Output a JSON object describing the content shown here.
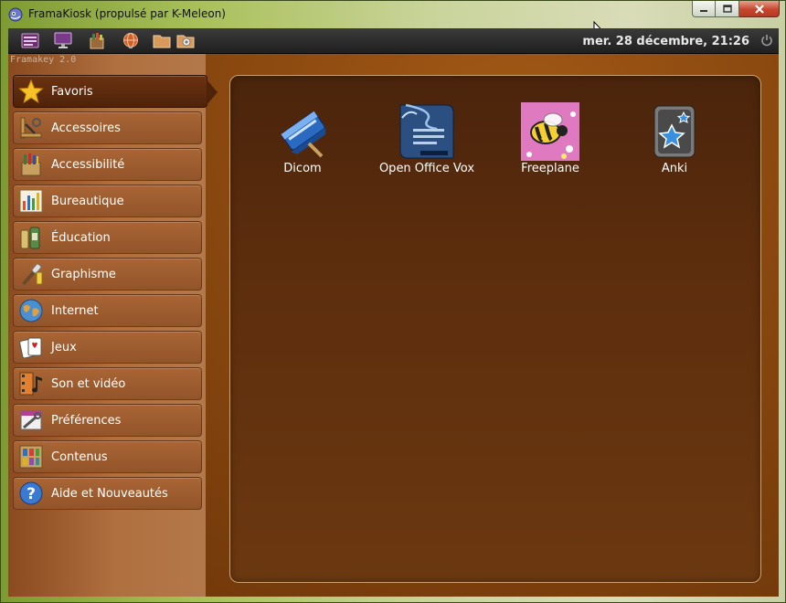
{
  "window": {
    "title": "FramaKiosk (propulsé par K-Meleon)",
    "controls": [
      "minimize-icon",
      "maximize-icon",
      "close-icon"
    ]
  },
  "toolbar": {
    "icons": [
      "menu-icon",
      "monitor-icon",
      "basket-icon",
      "globe-icon",
      "folder-icon",
      "settings-folder-icon"
    ],
    "clock": "mer. 28 décembre, 21:26",
    "power_icon": "power-icon"
  },
  "sidebar": {
    "brand": "Framakey 2.0",
    "items": [
      {
        "label": "Favoris",
        "icon": "star-icon",
        "active": true
      },
      {
        "label": "Accessoires",
        "icon": "accessories-icon"
      },
      {
        "label": "Accessibilité",
        "icon": "accessibility-icon"
      },
      {
        "label": "Bureautique",
        "icon": "office-icon"
      },
      {
        "label": "Éducation",
        "icon": "education-icon"
      },
      {
        "label": "Graphisme",
        "icon": "graphics-icon"
      },
      {
        "label": "Internet",
        "icon": "globe-icon"
      },
      {
        "label": "Jeux",
        "icon": "cards-icon"
      },
      {
        "label": "Son et vidéo",
        "icon": "media-icon"
      },
      {
        "label": "Préférences",
        "icon": "preferences-icon"
      },
      {
        "label": "Contenus",
        "icon": "contents-icon"
      },
      {
        "label": "Aide et Nouveautés",
        "icon": "help-icon"
      }
    ]
  },
  "favorites": [
    {
      "label": "Dicom",
      "icon": "dicom-icon"
    },
    {
      "label": "Open Office Vox",
      "icon": "openoffice-icon"
    },
    {
      "label": "Freeplane",
      "icon": "freeplane-icon"
    },
    {
      "label": "Anki",
      "icon": "anki-icon"
    }
  ],
  "colors": {
    "panel_border": "#c8a46c",
    "content_bg": "#8a4810",
    "sidebar_bg": "#b0703f"
  }
}
